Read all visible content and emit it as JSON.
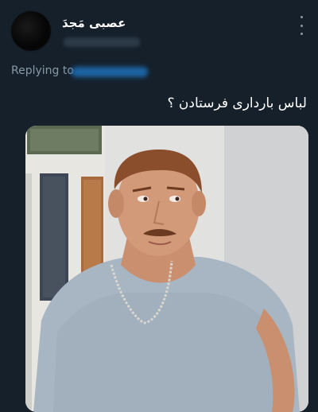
{
  "tweet": {
    "author": {
      "display_name": "عصبی مَجدَ",
      "avatar_icon": "avatar-blurred"
    },
    "replying_to_label": "Replying to",
    "text": "لباس بارداری فرستادن ؟",
    "more_icon": "more-vertical-icon",
    "media": {
      "alt": "photo"
    }
  },
  "colors": {
    "background": "#15202b",
    "secondary_text": "#8899a6",
    "link": "#1d9bf0"
  }
}
